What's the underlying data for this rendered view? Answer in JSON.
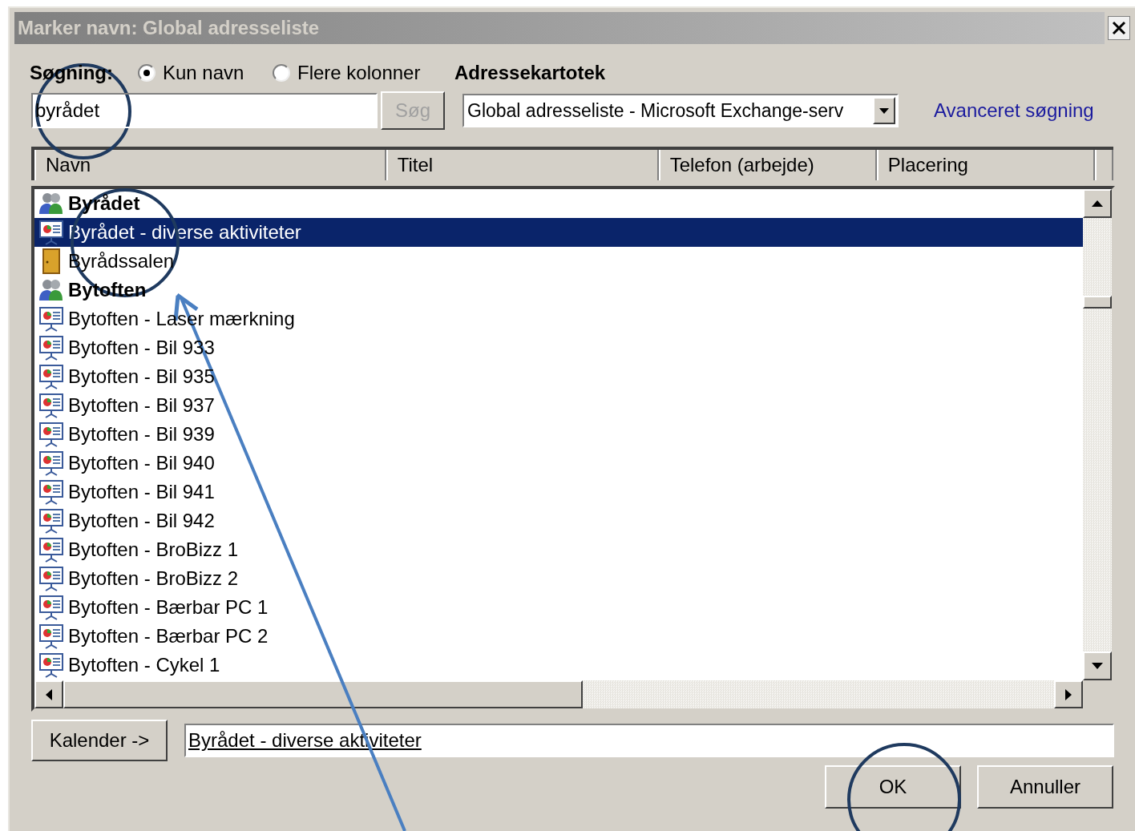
{
  "window": {
    "title": "Marker navn: Global adresseliste"
  },
  "search": {
    "label": "Søgning:",
    "options": [
      {
        "label": "Kun navn",
        "selected": true
      },
      {
        "label": "Flere kolonner",
        "selected": false
      }
    ],
    "value": "byrådet",
    "button": {
      "label": "Søg",
      "disabled": true
    }
  },
  "address_book": {
    "label": "Adressekartotek",
    "value": "Global adresseliste - Microsoft Exchange-serv",
    "advanced_link": "Avanceret søgning"
  },
  "table": {
    "columns": [
      "Navn",
      "Titel",
      "Telefon (arbejde)",
      "Placering"
    ],
    "rows": [
      {
        "kind": "group",
        "name": "Byrådet",
        "selected": false
      },
      {
        "kind": "resource",
        "name": "Byrådet - diverse aktiviteter",
        "selected": true
      },
      {
        "kind": "room",
        "name": "Byrådssalen",
        "selected": false
      },
      {
        "kind": "group",
        "name": "Bytoften",
        "selected": false
      },
      {
        "kind": "resource",
        "name": "Bytoften -  Laser mærkning",
        "selected": false
      },
      {
        "kind": "resource",
        "name": "Bytoften - Bil 933",
        "selected": false
      },
      {
        "kind": "resource",
        "name": "Bytoften - Bil 935",
        "selected": false
      },
      {
        "kind": "resource",
        "name": "Bytoften - Bil 937",
        "selected": false
      },
      {
        "kind": "resource",
        "name": "Bytoften - Bil 939",
        "selected": false
      },
      {
        "kind": "resource",
        "name": "Bytoften - Bil 940",
        "selected": false
      },
      {
        "kind": "resource",
        "name": "Bytoften - Bil 941",
        "selected": false
      },
      {
        "kind": "resource",
        "name": "Bytoften - Bil 942",
        "selected": false
      },
      {
        "kind": "resource",
        "name": "Bytoften - BroBizz 1",
        "selected": false
      },
      {
        "kind": "resource",
        "name": "Bytoften - BroBizz 2",
        "selected": false
      },
      {
        "kind": "resource",
        "name": "Bytoften - Bærbar PC 1",
        "selected": false
      },
      {
        "kind": "resource",
        "name": "Bytoften - Bærbar PC 2",
        "selected": false
      },
      {
        "kind": "resource",
        "name": "Bytoften - Cykel 1",
        "selected": false
      }
    ]
  },
  "calendar": {
    "button": "Kalender ->",
    "value": "Byrådet - diverse aktiviteter"
  },
  "buttons": [
    "OK",
    "Annuller"
  ]
}
